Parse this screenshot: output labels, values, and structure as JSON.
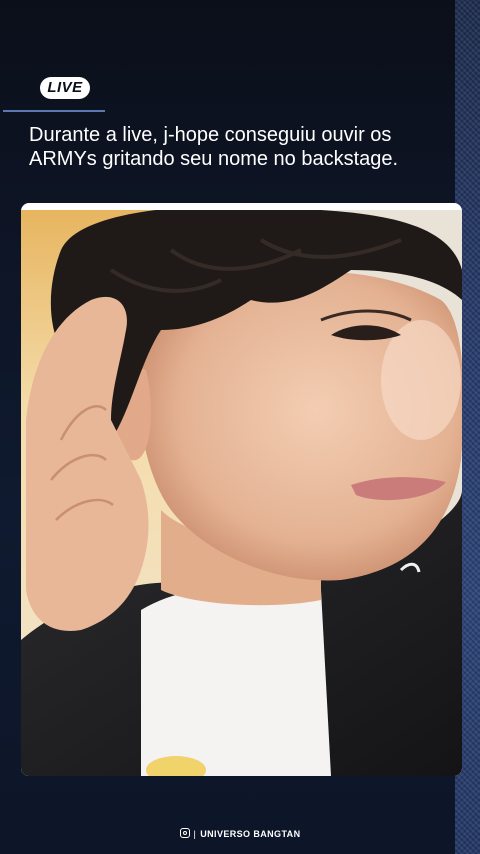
{
  "badge": {
    "label": "LIVE"
  },
  "headline": {
    "text": "Durante a live, j-hope conseguiu ouvir os ARMYs gritando seu nome no backstage."
  },
  "footer": {
    "separator": "|",
    "brand": "UNIVERSO BANGTAN",
    "icon": "instagram-icon"
  },
  "colors": {
    "background": "#0b0f1a",
    "accent": "#5b77b0",
    "denim": "#25396a"
  }
}
